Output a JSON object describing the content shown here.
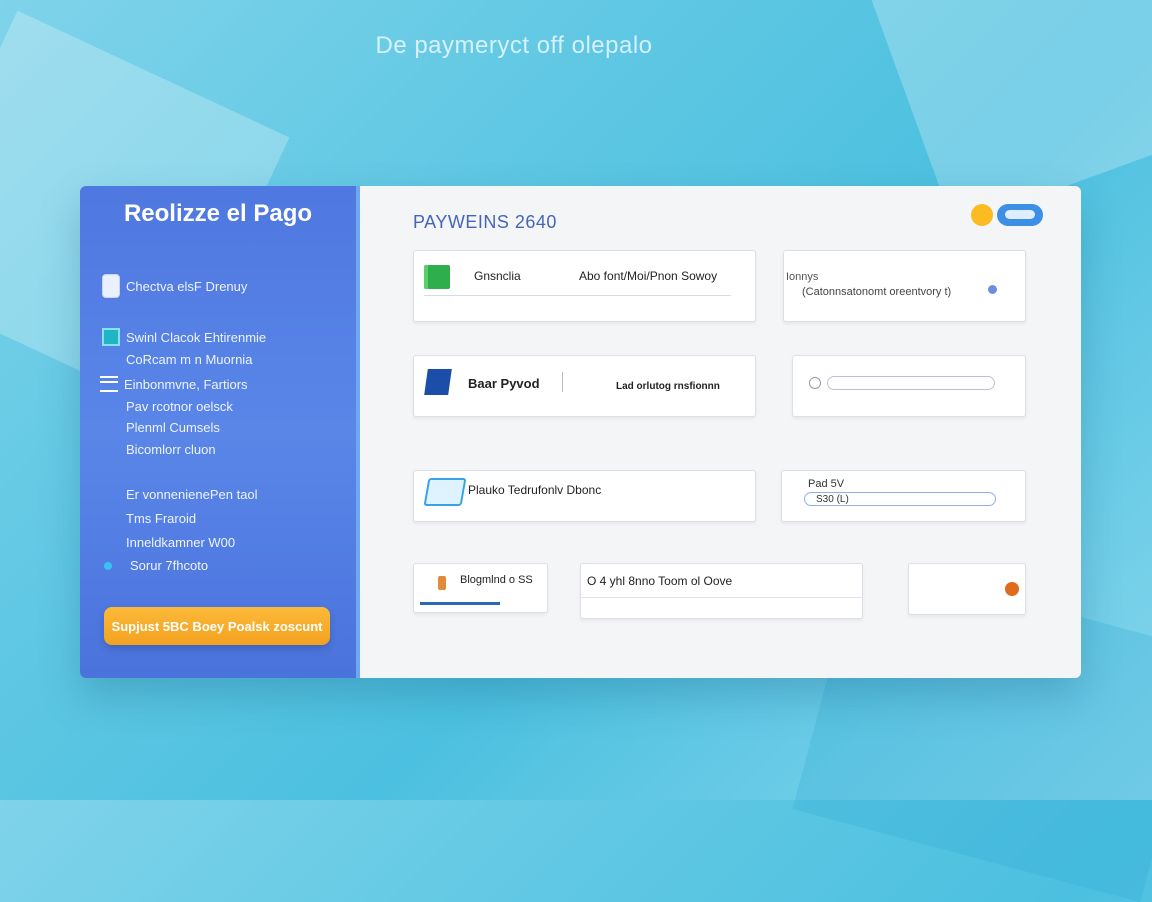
{
  "page_heading": "De paymeryct off olepalo",
  "left_panel": {
    "title": "Reolizze el Pago",
    "item1": "Chectva elsF Drenuy",
    "item2": "Swinl Clacok Ehtirenmie",
    "item3": "CoRcam m n Muornia",
    "item4": "Einbonmvne, Fartiors",
    "item5": "Pav rcotnor oelsck",
    "item6": "Plenml Cumsels",
    "item7": "Bicomlorr cluon",
    "item8": "Er vonnenienePen taol",
    "item9": "Tms Fraroid",
    "item10": "Inneldkamner W00",
    "item11": "Sorur 7fhcoto",
    "cta_label": "Supjust 5BC Boey Poalsk zoscunt"
  },
  "main": {
    "title": "PAYWEINS 2640",
    "row1_col1_label": "Gnsnclia",
    "row1_col1_desc": "Abo font/Moi/Pnon Sowoy",
    "row1_col2_label": "Ionnys",
    "row1_col2_desc": "(Catonnsatonomt oreentvory t)",
    "row2_col1_label": "Baar Pyvod",
    "row2_col1_desc": "Lad orlutog rnsfionnn",
    "row3_col1_label": "Plauko Tedrufonlv Dbonc",
    "row3_col2_label": "Pad 5V",
    "row3_col2_value": "S30 (L)",
    "row4_col1_label": "Blogmlnd o SS",
    "row4_col2_label": "O 4 yhl 8nno Toom ol Oove"
  },
  "colors": {
    "accent": "#4f78e0",
    "cta": "#f3a21f",
    "title": "#4666b5"
  }
}
